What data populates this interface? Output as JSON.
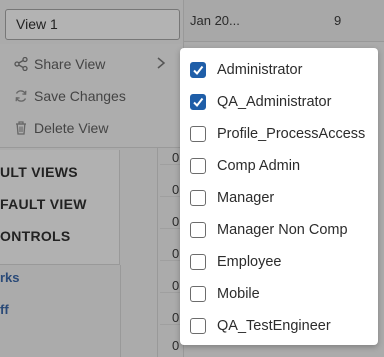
{
  "view_selector": {
    "current_value": "View 1"
  },
  "view_menu": {
    "share_label": "Share View",
    "save_label": "Save Changes",
    "delete_label": "Delete View"
  },
  "sidebar": {
    "labels": [
      "ULT VIEWS",
      "FAULT VIEW",
      "ONTROLS"
    ],
    "links": [
      "rks",
      "ff"
    ]
  },
  "grid": {
    "header_date": "Jan 20...",
    "header_value": "9",
    "cells": [
      "0",
      "0",
      "0",
      "0",
      "0",
      "0",
      "0",
      "0"
    ]
  },
  "share_popup": {
    "roles": [
      {
        "label": "Administrator",
        "checked": true
      },
      {
        "label": "QA_Administrator",
        "checked": true
      },
      {
        "label": "Profile_ProcessAccess",
        "checked": false
      },
      {
        "label": "Comp Admin",
        "checked": false
      },
      {
        "label": "Manager",
        "checked": false
      },
      {
        "label": "Manager Non Comp",
        "checked": false
      },
      {
        "label": "Employee",
        "checked": false
      },
      {
        "label": "Mobile",
        "checked": false
      },
      {
        "label": "QA_TestEngineer",
        "checked": false
      }
    ]
  },
  "colors": {
    "checkbox_checked": "#1f5ea8",
    "overlay": "#ababab"
  }
}
